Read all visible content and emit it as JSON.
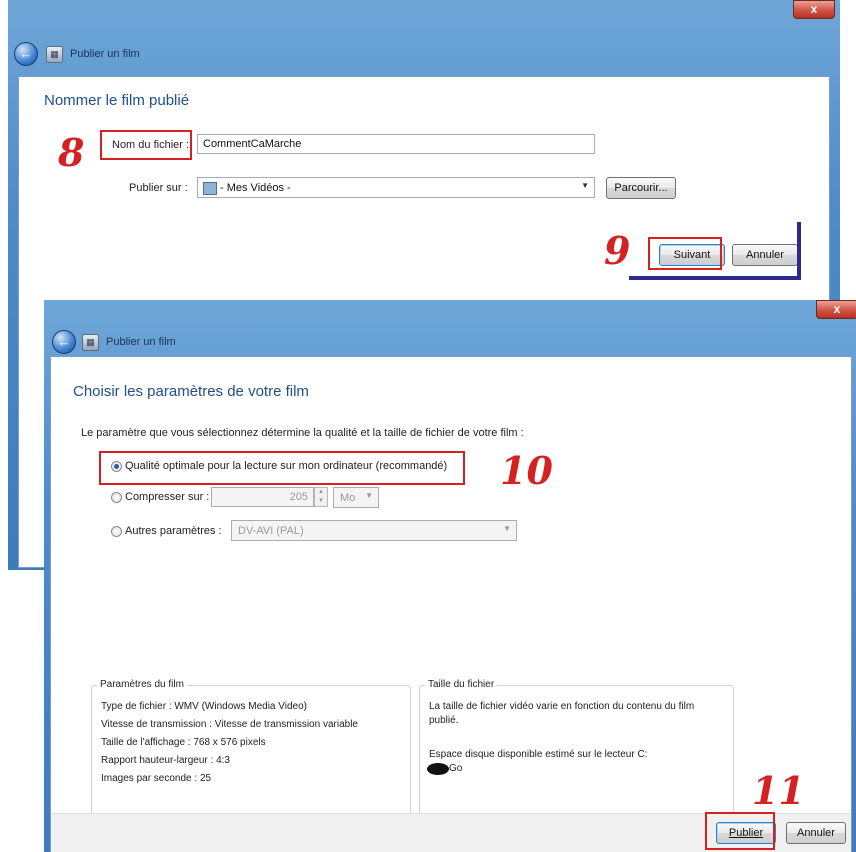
{
  "window1": {
    "title": "Publier un film",
    "close": "x",
    "heading": "Nommer le film publié",
    "filename_label": "Nom du fichier :",
    "filename_value": "CommentCaMarche",
    "publish_on_label": "Publier sur :",
    "publish_on_value": "- Mes Vidéos -",
    "browse_button": "Parcourir...",
    "next_button": "Suivant",
    "cancel_button": "Annuler"
  },
  "window2": {
    "title": "Publier un film",
    "close": "x",
    "heading": "Choisir les paramètres de votre film",
    "instruction": "Le paramètre que vous sélectionnez détermine la qualité et la taille de fichier de votre film :",
    "options": {
      "optimal": "Qualité optimale pour la lecture sur mon ordinateur (recommandé)",
      "compress_label": "Compresser sur :",
      "compress_value": "205",
      "compress_unit": "Mo",
      "other_label": "Autres paramètres :",
      "other_value": "DV-AVI (PAL)"
    },
    "film_params": {
      "legend": "Paramètres du film",
      "lines": [
        "Type de fichier : WMV (Windows Media Video)",
        "Vitesse de transmission : Vitesse de transmission variable",
        "Taille de l'affichage : 768 x 576 pixels",
        "Rapport hauteur-largeur : 4:3",
        "Images par seconde : 25"
      ]
    },
    "file_size": {
      "legend": "Taille du fichier",
      "text1": "La taille de fichier vidéo varie en fonction du contenu du film",
      "text2": "publié.",
      "text3": "Espace disque disponible estimé sur le lecteur C:",
      "text4": "Go"
    },
    "publish_button": "Publier",
    "cancel_button": "Annuler"
  },
  "annotations": {
    "step8": "8",
    "step9": "9",
    "step10": "10",
    "step11": "11"
  },
  "colors": {
    "annotation_red": "#d42121",
    "heading_blue": "#1f4f8d",
    "titlebar_blue": "#4f8cc9"
  }
}
